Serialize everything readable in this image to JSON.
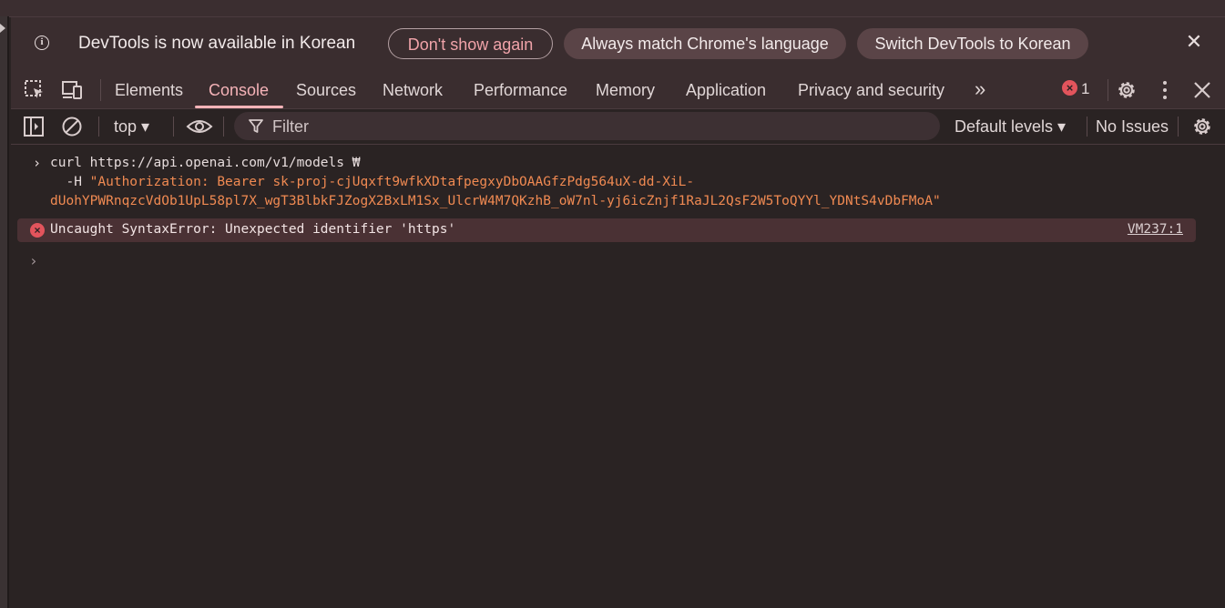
{
  "infobar": {
    "message": "DevTools is now available in Korean",
    "dont_show": "Don't show again",
    "always_match": "Always match Chrome's language",
    "switch_korean": "Switch DevTools to Korean",
    "close_symbol": "✕"
  },
  "tabs": [
    {
      "label": "Elements"
    },
    {
      "label": "Console",
      "active": true
    },
    {
      "label": "Sources"
    },
    {
      "label": "Network"
    },
    {
      "label": "Performance"
    },
    {
      "label": "Memory"
    },
    {
      "label": "Application"
    },
    {
      "label": "Privacy and security"
    }
  ],
  "tabbar": {
    "more_symbol": "»",
    "error_count": "1"
  },
  "console_toolbar": {
    "context": "top ▾",
    "filter_placeholder": "Filter",
    "levels": "Default levels ▾",
    "issues": "No Issues"
  },
  "console": {
    "command_line1": "curl https://api.openai.com/v1/models ₩",
    "command_line2_prefix": "  -H ",
    "command_line2_string": "\"Authorization: Bearer sk-proj-cjUqxft9wfkXDtafpegxyDbOAAGfzPdg564uX-dd-XiL-",
    "command_line3_string": "dUohYPWRnqzcVdOb1UpL58pl7X_wgT3BlbkFJZogX2BxLM1Sx_UlcrW4M7QKzhB_oW7nl-yj6icZnjf1RaJL2QsF2W5ToQYYl_YDNtS4vDbFMoA\"",
    "error_message": "Uncaught SyntaxError: Unexpected identifier 'https'",
    "error_source": "VM237:1"
  },
  "colors": {
    "background": "#2a2323",
    "accent": "#f5b3b8",
    "error": "#e2545c",
    "string": "#f08a52"
  }
}
